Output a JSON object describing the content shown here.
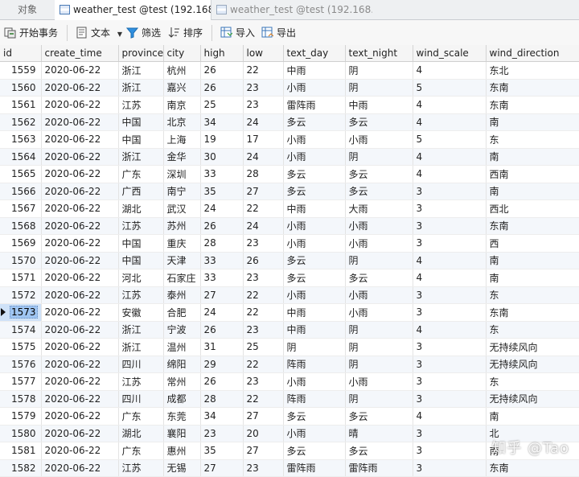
{
  "tabs": [
    {
      "label": "对象"
    },
    {
      "label": "weather_test @test (192.168..."
    },
    {
      "label": "weather_test @test (192.168..."
    }
  ],
  "toolbar": {
    "begin_transaction": "开始事务",
    "text": "文本",
    "filter": "筛选",
    "sort": "排序",
    "import": "导入",
    "export": "导出"
  },
  "table": {
    "columns": [
      "id",
      "create_time",
      "province",
      "city",
      "high",
      "low",
      "text_day",
      "text_night",
      "wind_scale",
      "wind_direction"
    ],
    "current_row_id": "1573",
    "rows": [
      [
        "1559",
        "2020-06-22",
        "浙江",
        "杭州",
        "26",
        "22",
        "中雨",
        "阴",
        "4",
        "东北"
      ],
      [
        "1560",
        "2020-06-22",
        "浙江",
        "嘉兴",
        "26",
        "23",
        "小雨",
        "阴",
        "5",
        "东南"
      ],
      [
        "1561",
        "2020-06-22",
        "江苏",
        "南京",
        "25",
        "23",
        "雷阵雨",
        "中雨",
        "4",
        "东南"
      ],
      [
        "1562",
        "2020-06-22",
        "中国",
        "北京",
        "34",
        "24",
        "多云",
        "多云",
        "4",
        "南"
      ],
      [
        "1563",
        "2020-06-22",
        "中国",
        "上海",
        "19",
        "17",
        "小雨",
        "小雨",
        "5",
        "东"
      ],
      [
        "1564",
        "2020-06-22",
        "浙江",
        "金华",
        "30",
        "24",
        "小雨",
        "阴",
        "4",
        "南"
      ],
      [
        "1565",
        "2020-06-22",
        "广东",
        "深圳",
        "33",
        "28",
        "多云",
        "多云",
        "4",
        "西南"
      ],
      [
        "1566",
        "2020-06-22",
        "广西",
        "南宁",
        "35",
        "27",
        "多云",
        "多云",
        "3",
        "南"
      ],
      [
        "1567",
        "2020-06-22",
        "湖北",
        "武汉",
        "24",
        "22",
        "中雨",
        "大雨",
        "3",
        "西北"
      ],
      [
        "1568",
        "2020-06-22",
        "江苏",
        "苏州",
        "26",
        "24",
        "小雨",
        "小雨",
        "3",
        "东南"
      ],
      [
        "1569",
        "2020-06-22",
        "中国",
        "重庆",
        "28",
        "23",
        "小雨",
        "小雨",
        "3",
        "西"
      ],
      [
        "1570",
        "2020-06-22",
        "中国",
        "天津",
        "33",
        "26",
        "多云",
        "阴",
        "4",
        "南"
      ],
      [
        "1571",
        "2020-06-22",
        "河北",
        "石家庄",
        "33",
        "23",
        "多云",
        "多云",
        "4",
        "南"
      ],
      [
        "1572",
        "2020-06-22",
        "江苏",
        "泰州",
        "27",
        "22",
        "小雨",
        "小雨",
        "3",
        "东"
      ],
      [
        "1573",
        "2020-06-22",
        "安徽",
        "合肥",
        "24",
        "22",
        "中雨",
        "小雨",
        "3",
        "东南"
      ],
      [
        "1574",
        "2020-06-22",
        "浙江",
        "宁波",
        "26",
        "23",
        "中雨",
        "阴",
        "4",
        "东"
      ],
      [
        "1575",
        "2020-06-22",
        "浙江",
        "温州",
        "31",
        "25",
        "阴",
        "阴",
        "3",
        "无持续风向"
      ],
      [
        "1576",
        "2020-06-22",
        "四川",
        "绵阳",
        "29",
        "22",
        "阵雨",
        "阴",
        "3",
        "无持续风向"
      ],
      [
        "1577",
        "2020-06-22",
        "江苏",
        "常州",
        "26",
        "23",
        "小雨",
        "小雨",
        "3",
        "东"
      ],
      [
        "1578",
        "2020-06-22",
        "四川",
        "成都",
        "28",
        "22",
        "阵雨",
        "阴",
        "3",
        "无持续风向"
      ],
      [
        "1579",
        "2020-06-22",
        "广东",
        "东莞",
        "34",
        "27",
        "多云",
        "多云",
        "4",
        "南"
      ],
      [
        "1580",
        "2020-06-22",
        "湖北",
        "襄阳",
        "23",
        "20",
        "小雨",
        "晴",
        "3",
        "北"
      ],
      [
        "1581",
        "2020-06-22",
        "广东",
        "惠州",
        "35",
        "27",
        "多云",
        "多云",
        "3",
        "南"
      ],
      [
        "1582",
        "2020-06-22",
        "江苏",
        "无锡",
        "27",
        "23",
        "雷阵雨",
        "雷阵雨",
        "3",
        "东南"
      ]
    ]
  },
  "watermark": "知乎 @Tao",
  "colors": {
    "accent": "#1e6fd9",
    "row_alt": "#f4f7fb",
    "selection": "#9fc5f2"
  }
}
